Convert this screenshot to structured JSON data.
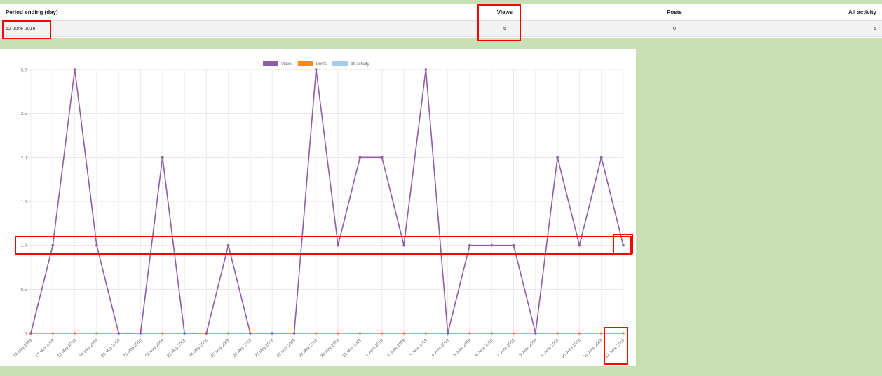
{
  "table": {
    "headers": {
      "period": "Period ending (day)",
      "views": "Views",
      "posts": "Posts",
      "all_activity": "All activity"
    },
    "row": {
      "period": "12 June 2019",
      "views": "5",
      "posts": "0",
      "all_activity": "5"
    }
  },
  "colors": {
    "views": "#8e5ea2",
    "posts": "#ff8c00",
    "all_activity": "#a7cbea",
    "highlight": "#ff0000",
    "page_bg": "#c8e0b4"
  },
  "chart_data": {
    "type": "line",
    "x": [
      "16 May 2019",
      "17 May 2019",
      "18 May 2019",
      "19 May 2019",
      "20 May 2019",
      "21 May 2019",
      "22 May 2019",
      "23 May 2019",
      "24 May 2019",
      "25 May 2019",
      "26 May 2019",
      "27 May 2019",
      "28 May 2019",
      "29 May 2019",
      "30 May 2019",
      "31 May 2019",
      "1 June 2019",
      "2 June 2019",
      "3 June 2019",
      "4 June 2019",
      "5 June 2019",
      "6 June 2019",
      "7 June 2019",
      "8 June 2019",
      "9 June 2019",
      "10 June 2019",
      "11 June 2019",
      "12 June 2019"
    ],
    "series": [
      {
        "name": "Views",
        "values": [
          0,
          1,
          3,
          1,
          0,
          0,
          2,
          0,
          0,
          1,
          0,
          0,
          0,
          3,
          1,
          2,
          2,
          1,
          3,
          0,
          1,
          1,
          1,
          0,
          2,
          1,
          2,
          1
        ]
      },
      {
        "name": "Posts",
        "values": [
          0,
          0,
          0,
          0,
          0,
          0,
          0,
          0,
          0,
          0,
          0,
          0,
          0,
          0,
          0,
          0,
          0,
          0,
          0,
          0,
          0,
          0,
          0,
          0,
          0,
          0,
          0,
          0
        ]
      },
      {
        "name": "All activity",
        "values": []
      }
    ],
    "yticks": [
      "0",
      "0.5",
      "1.0",
      "1.5",
      "2.0",
      "2.5",
      "3.0"
    ],
    "ylim": [
      0,
      3
    ],
    "legend": "top-center",
    "grid": true,
    "title": "",
    "xlabel": "",
    "ylabel": ""
  }
}
